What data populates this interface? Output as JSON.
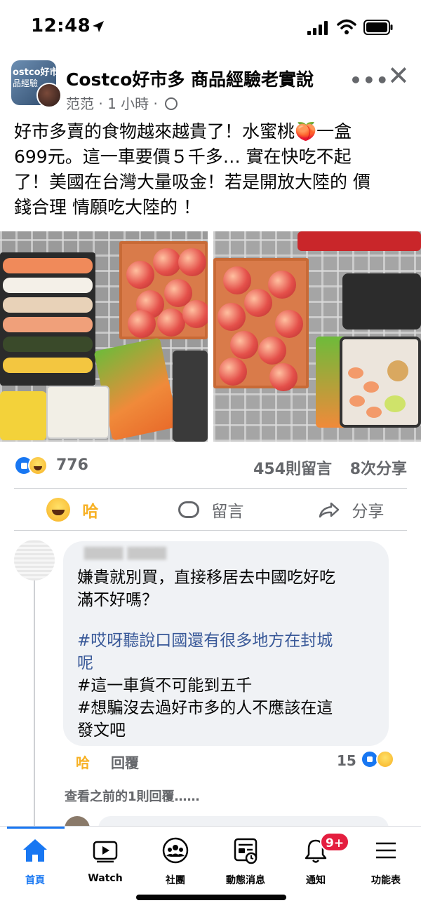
{
  "status_bar": {
    "time": "12:48"
  },
  "post": {
    "group_name": "Costco好市多 商品經驗老實說",
    "avatar_text_line1": "ostco好市",
    "avatar_text_line2": "品經驗",
    "author": "范范",
    "timestamp": "1 小時",
    "body_lines": [
      "好市多賣的食物越來越貴了！水蜜桃🍑一盒",
      "699元。這一車要價５千多… 實在快吃不起",
      "了！美國在台灣大量吸金！若是開放大陸的 價",
      "錢合理 情願吃大陸的 ！"
    ],
    "reaction_count": "776",
    "comment_count": "454則留言",
    "share_count": "8次分享"
  },
  "actions": {
    "haha_label": "哈",
    "comment_label": "留言",
    "share_label": "分享"
  },
  "comment": {
    "line1": "嫌貴就別買，直接移居去中國吃好吃",
    "line2": "滿不好嗎？",
    "hashtag1_line1": "#哎呀聽說口國還有很多地方在封城",
    "hashtag1_line2": "呢",
    "hashtag2": "#這一車貨不可能到五千",
    "hashtag3_line1": "#想騙沒去過好市多的人不應該在這",
    "hashtag3_line2": "發文吧",
    "haha_label": "哈",
    "reply_label": "回覆",
    "reaction_count": "15",
    "view_previous": "查看之前的1則回覆……"
  },
  "tab_bar": {
    "tabs": [
      {
        "label": "首頁",
        "icon": "home-icon",
        "active": true
      },
      {
        "label": "Watch",
        "icon": "watch-icon",
        "active": false
      },
      {
        "label": "社團",
        "icon": "groups-icon",
        "active": false
      },
      {
        "label": "動態消息",
        "icon": "feed-icon",
        "active": false
      },
      {
        "label": "通知",
        "icon": "bell-icon",
        "active": false
      },
      {
        "label": "功能表",
        "icon": "menu-icon",
        "active": false
      }
    ],
    "notification_badge": "9+"
  },
  "colors": {
    "accent": "#1877f2",
    "haha": "#f7b125",
    "hashtag": "#385898",
    "badge": "#e41e3f"
  }
}
